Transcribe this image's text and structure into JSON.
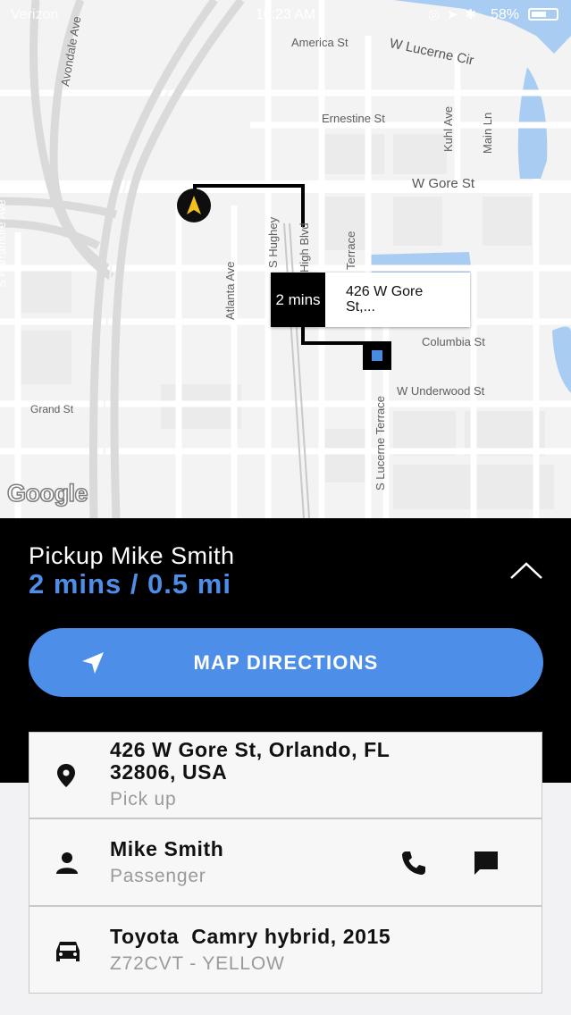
{
  "status_bar": {
    "carrier": "Verizon",
    "time": "10:23 AM",
    "battery": "58%"
  },
  "map": {
    "streets": {
      "america_st": "America St",
      "w_lucerne_cir": "W Lucerne Cir",
      "ernestine_st": "Ernestine St",
      "kuhl_ave": "Kuhl Ave",
      "main_ln": "Main Ln",
      "w_gore_st": "W Gore St",
      "avondale_ave": "Avondale Ave",
      "s_parramore_ave": "S Parramore Ave",
      "s_hughey_ave": "S Hughey",
      "orange_blossom_trail": "High Blvd",
      "terrace": "Terrace",
      "atlanta_ave": "Atlanta Ave",
      "columbia_st": "Columbia St",
      "w_underwood_st": "W Underwood St",
      "grand_st": "Grand St",
      "s_lucerne_terrace": "S Lucerne Terrace"
    },
    "google_logo": "Google",
    "eta_bubble": {
      "time": "2 mins",
      "address": "426 W Gore St,..."
    }
  },
  "trip": {
    "pickup_title": "Pickup Mike Smith",
    "eta_distance": "2 mins / 0.5 mi",
    "directions_label": "MAP DIRECTIONS"
  },
  "pickup": {
    "address": "426 W Gore St, Orlando, FL 32806, USA",
    "label": "Pick up"
  },
  "passenger": {
    "name": "Mike Smith",
    "label": "Passenger"
  },
  "vehicle": {
    "model": "Toyota  Camry hybrid, 2015",
    "plate_color": "Z72CVT - YELLOW"
  },
  "colors": {
    "accent": "#4d8ee8",
    "panel": "#000000"
  }
}
